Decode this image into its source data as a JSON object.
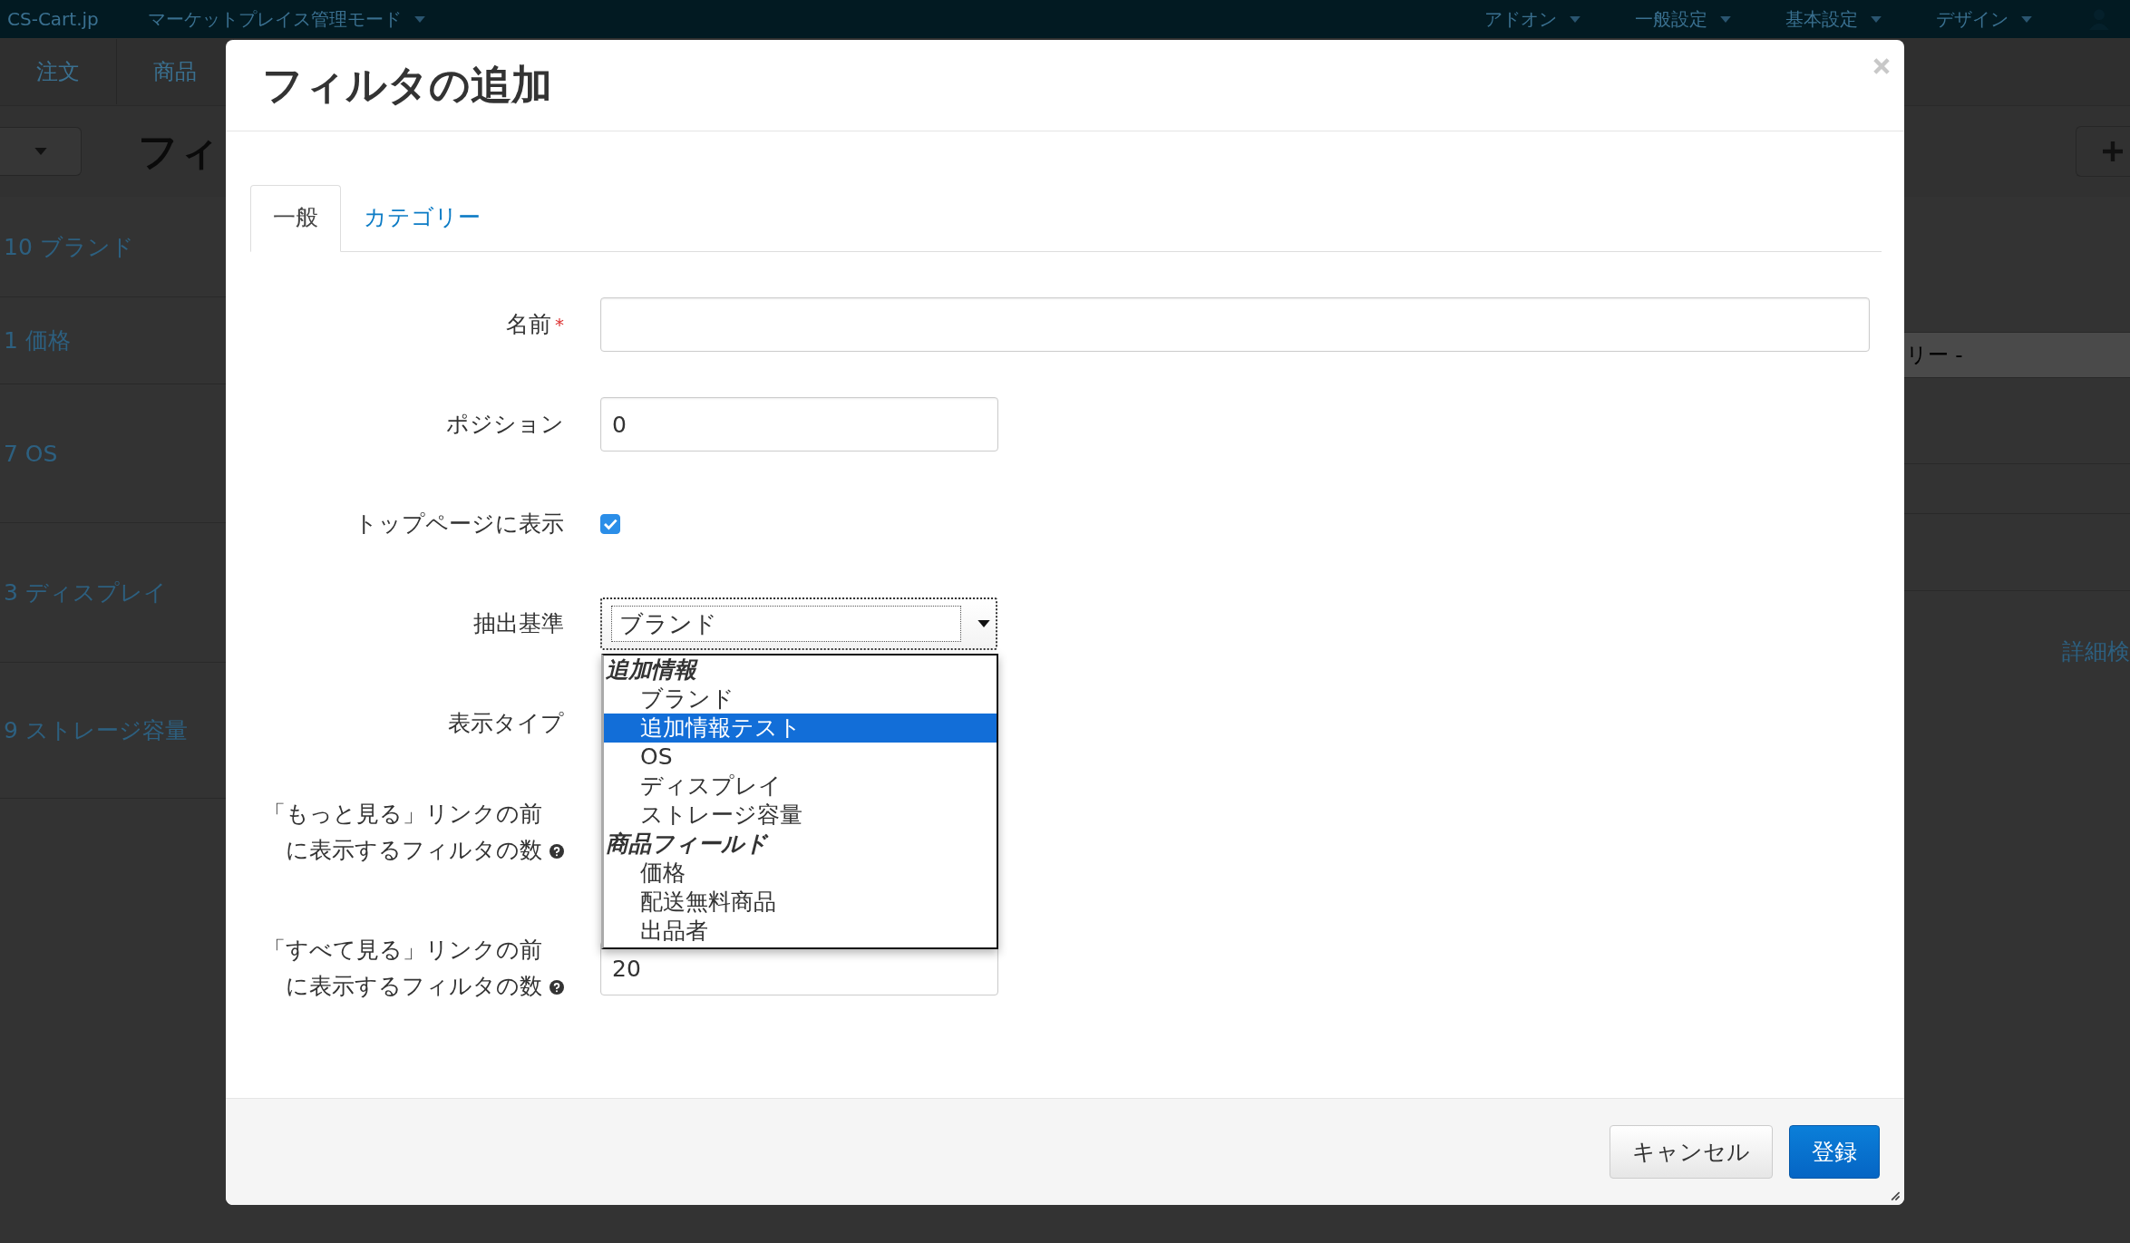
{
  "background": {
    "topbar": {
      "brand": "CS-Cart.jp",
      "mode": "マーケットプレイス管理モード",
      "menus": [
        "アドオン",
        "一般設定",
        "基本設定",
        "デザイン"
      ]
    },
    "nav": [
      "注文",
      "商品"
    ],
    "page_title": "フィ",
    "list": [
      "10 ブランド",
      "1 価格",
      "7 OS",
      "3 ディスプレイ",
      "9 ストレージ容量"
    ],
    "right_texts": [
      "リー -",
      "詳細検"
    ]
  },
  "modal": {
    "title": "フィルタの追加",
    "tabs": [
      {
        "label": "一般",
        "selected": true
      },
      {
        "label": "カテゴリー",
        "selected": false
      }
    ],
    "fields": [
      {
        "kind": "text",
        "label": "名前",
        "required_mark": "*"
      },
      {
        "kind": "text",
        "label": "ポジション",
        "value": "0"
      },
      {
        "kind": "checkbox",
        "label": "トップページに表示",
        "checked": true
      },
      {
        "kind": "select",
        "label": "抽出基準",
        "value": "ブランド",
        "expanded": true
      },
      {
        "kind": "covered",
        "label": "表示タイプ"
      },
      {
        "kind": "covered",
        "label": "「もっと見る」リンクの前に表示するフィルタの数",
        "help": true
      },
      {
        "kind": "text",
        "label": "「すべて見る」リンクの前に表示するフィルタの数",
        "help": true,
        "value": "20"
      }
    ],
    "dropdown": [
      {
        "group": "追加情報",
        "options": [
          {
            "label": "ブランド",
            "selected": false
          },
          {
            "label": "追加情報テスト",
            "selected": true
          },
          {
            "label": "OS",
            "selected": false
          },
          {
            "label": "ディスプレイ",
            "selected": false
          },
          {
            "label": "ストレージ容量",
            "selected": false
          }
        ]
      },
      {
        "group": "商品フィールド",
        "options": [
          {
            "label": "価格",
            "selected": false
          },
          {
            "label": "配送無料商品",
            "selected": false
          },
          {
            "label": "出品者",
            "selected": false
          }
        ]
      }
    ],
    "buttons": [
      {
        "kind": "secondary",
        "label": "キャンセル"
      },
      {
        "kind": "primary",
        "label": "登録"
      }
    ]
  }
}
